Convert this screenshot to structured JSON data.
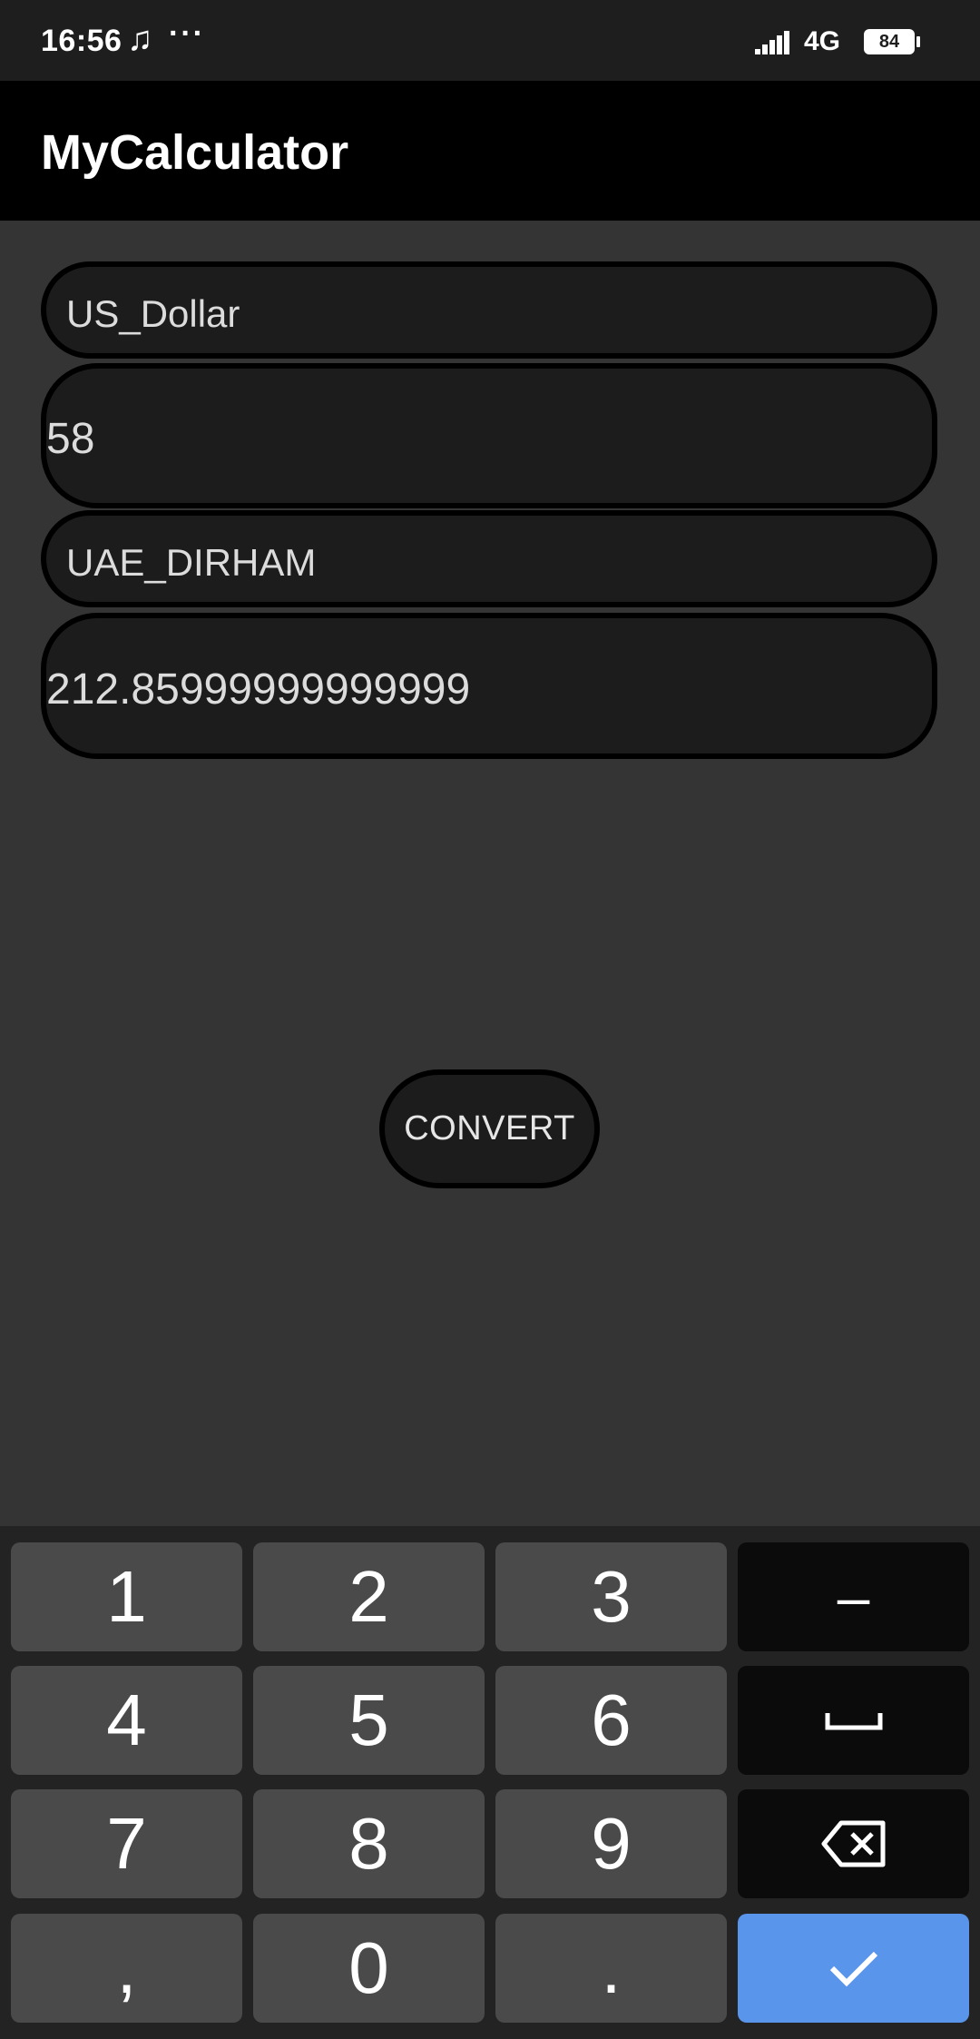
{
  "status_bar": {
    "time": "16:56",
    "music_icon": "music-note-icon",
    "more_dots": "···",
    "network": "4G",
    "battery": "84"
  },
  "app_bar": {
    "title": "MyCalculator"
  },
  "form": {
    "from_currency": "US_Dollar",
    "amount": "58",
    "to_currency": "UAE_DIRHAM",
    "result": "212.85999999999999",
    "convert_label": "CONVERT"
  },
  "keyboard": {
    "keys": [
      "1",
      "2",
      "3",
      "–",
      "4",
      "5",
      "6",
      "space",
      "7",
      "8",
      "9",
      "backspace",
      ",",
      "0",
      ".",
      "done"
    ],
    "k1": "1",
    "k2": "2",
    "k3": "3",
    "minus": "–",
    "k4": "4",
    "k5": "5",
    "k6": "6",
    "k7": "7",
    "k8": "8",
    "k9": "9",
    "comma": ",",
    "k0": "0",
    "period": ".",
    "enter_color": "#5a95ec"
  }
}
